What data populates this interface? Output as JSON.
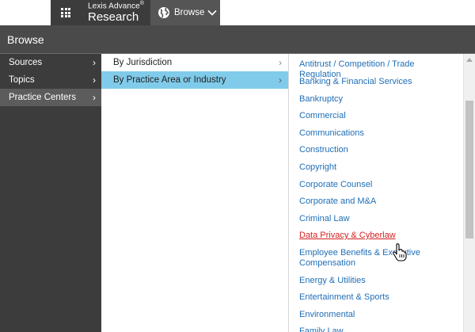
{
  "topbar": {
    "apps_icon": "grid-icon",
    "brand_line1": "Lexis Advance",
    "brand_reg": "®",
    "brand_line2": "Research",
    "browse_label": "Browse",
    "browse_icon": "globe-icon",
    "chevron_icon": "chevron-down-icon"
  },
  "header": {
    "title": "Browse"
  },
  "col1": {
    "items": [
      {
        "label": "Sources",
        "arrow": "›"
      },
      {
        "label": "Topics",
        "arrow": "›"
      },
      {
        "label": "Practice Centers",
        "arrow": "›"
      }
    ],
    "active_index": 2
  },
  "col2": {
    "items": [
      {
        "label": "By Jurisdiction",
        "arrow": "›"
      },
      {
        "label": "By Practice Area or Industry",
        "arrow": "›"
      }
    ],
    "active_index": 1
  },
  "col3": {
    "items": [
      "Antitrust / Competition / Trade Regulation",
      "Banking & Financial Services",
      "Bankruptcy",
      "Commercial",
      "Communications",
      "Construction",
      "Copyright",
      "Corporate Counsel",
      "Corporate and M&A",
      "Criminal Law",
      "Data Privacy & Cyberlaw",
      "Employee Benefits & Executive Compensation",
      "Energy & Utilities",
      "Entertainment & Sports",
      "Environmental",
      "Family Law"
    ],
    "hover_index": 10
  },
  "colors": {
    "topbar_dark": "#3c3c3c",
    "browse_tab": "#555555",
    "header_bg": "#4a4a4a",
    "active_highlight": "#80cbea",
    "link_blue": "#1f6eb7",
    "link_hover_red": "#d42020"
  }
}
